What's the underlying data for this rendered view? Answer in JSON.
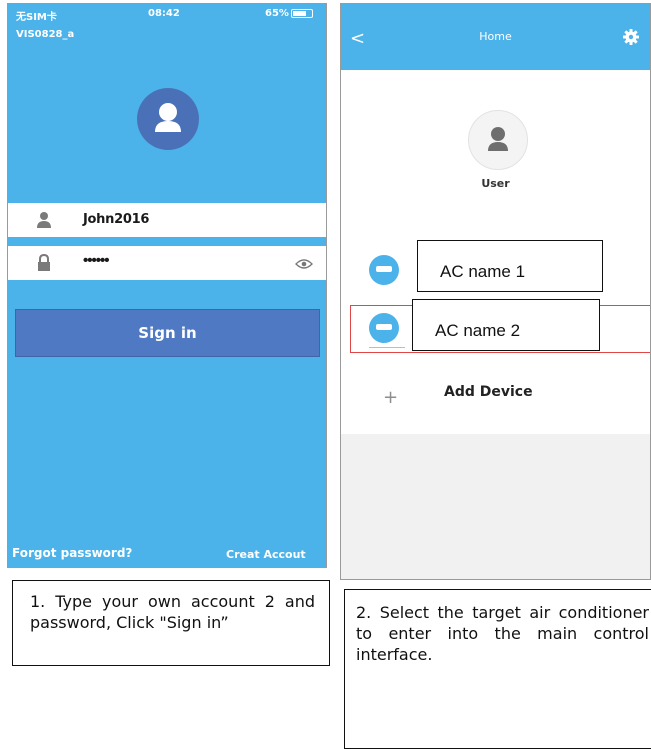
{
  "login_screen": {
    "status_bar": {
      "carrier": "无SIM卡",
      "time": "08:42",
      "battery": "65%"
    },
    "ssid": "VIS0828_a",
    "username": "John2016",
    "password_mask": "••••••",
    "sign_in_label": "Sign in",
    "forgot_password_label": "Forgot password?",
    "create_account_label": "Creat Accout",
    "icons": [
      "user-avatar-icon",
      "person-icon",
      "lock-icon",
      "eye-icon"
    ],
    "accent_color": "#4cb2ea",
    "button_color": "#4f79c3"
  },
  "home_screen": {
    "back_label": "<",
    "title": "Home",
    "user_label": "User",
    "devices": [
      {
        "label": "AC name 1"
      },
      {
        "label": "AC name 2"
      }
    ],
    "add_plus": "+",
    "add_device_label": "Add Device",
    "icons": [
      "back-icon",
      "gear-icon",
      "user-icon",
      "air-conditioner-icon",
      "plus-icon"
    ],
    "selected_device": "AC name 2",
    "highlight_color": "#e04848"
  },
  "captions": {
    "step1": "1. Type your own account 2 and password, Click \"Sign in”",
    "step2": "2. Select the target air conditioner to enter into the main control interface."
  }
}
